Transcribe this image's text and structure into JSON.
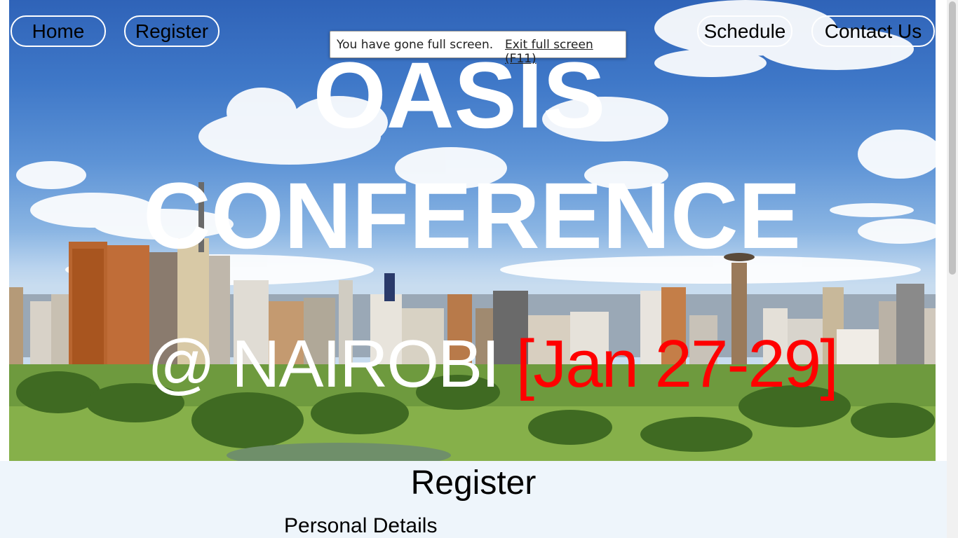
{
  "nav": {
    "home_label": "Home",
    "register_label": "Register",
    "schedule_label": "Schedule",
    "contact_label": "Contact Us"
  },
  "fullscreen_toast": {
    "message": "You have gone full screen.",
    "exit_label": "Exit full screen (F11)"
  },
  "hero": {
    "title_line1": "OASIS",
    "title_line2": "CONFERENCE",
    "location": "@ NAIROBI ",
    "dates": "[Jan 27-29]",
    "colors": {
      "title": "#ffffff",
      "dates": "#ff0000"
    }
  },
  "register": {
    "heading": "Register",
    "section_heading": "Personal Details"
  }
}
